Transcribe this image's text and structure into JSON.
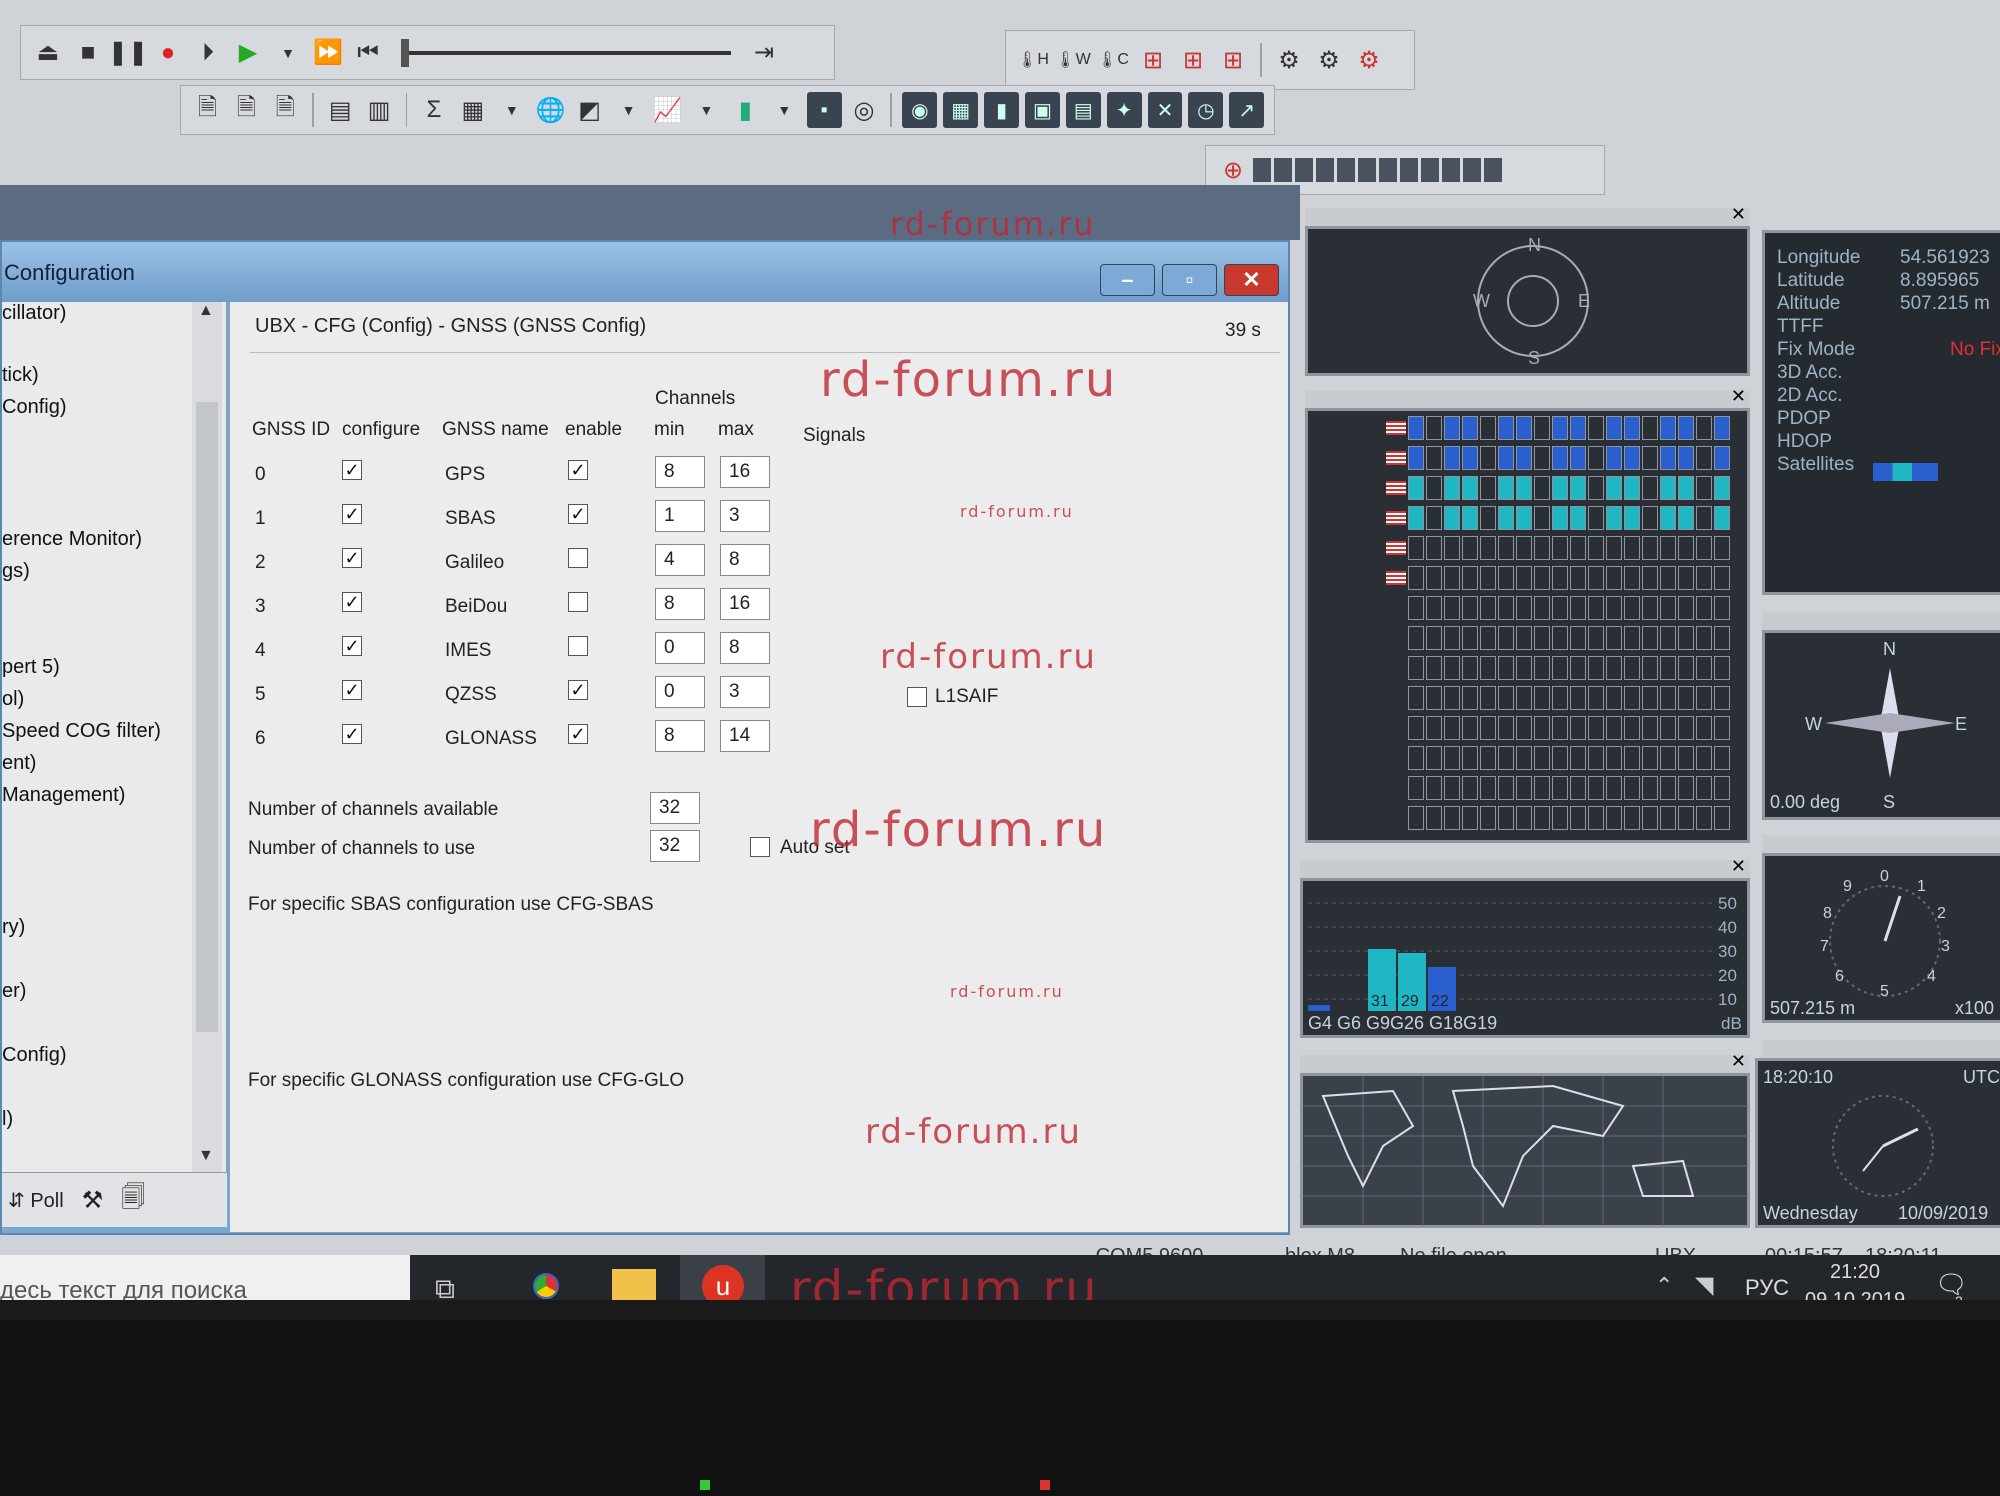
{
  "toolbar": {
    "playback_icons": [
      "eject-icon",
      "stop-icon",
      "pause-icon",
      "record-icon",
      "step-icon",
      "play-icon",
      "dropdown-icon",
      "fast-forward-icon",
      "skip-start-icon"
    ],
    "end_icon": "skip-end-icon",
    "view_icons_row1": [
      "H",
      "W",
      "C"
    ]
  },
  "watermark": "rd-forum.ru",
  "config_window": {
    "title": "Configuration",
    "page_title": "UBX - CFG (Config) - GNSS (GNSS Config)",
    "timer": "39 s",
    "nav_items": [
      "cillator)",
      "tick)",
      "Config)",
      "erence Monitor)",
      "gs)",
      "pert 5)",
      "ol)",
      "Speed COG filter)",
      "ent)",
      "Management)",
      "ry)",
      "er)",
      "Config)",
      "l)"
    ],
    "poll_label": "Poll",
    "headers": {
      "channels": "Channels",
      "gnss_id": "GNSS ID",
      "configure": "configure",
      "gnss_name": "GNSS name",
      "enable": "enable",
      "min": "min",
      "max": "max",
      "signals": "Signals"
    },
    "rows": [
      {
        "id": "0",
        "name": "GPS",
        "configure": true,
        "enable": true,
        "min": "8",
        "max": "16"
      },
      {
        "id": "1",
        "name": "SBAS",
        "configure": true,
        "enable": true,
        "min": "1",
        "max": "3"
      },
      {
        "id": "2",
        "name": "Galileo",
        "configure": true,
        "enable": false,
        "min": "4",
        "max": "8"
      },
      {
        "id": "3",
        "name": "BeiDou",
        "configure": true,
        "enable": false,
        "min": "8",
        "max": "16"
      },
      {
        "id": "4",
        "name": "IMES",
        "configure": true,
        "enable": false,
        "min": "0",
        "max": "8"
      },
      {
        "id": "5",
        "name": "QZSS",
        "configure": true,
        "enable": true,
        "min": "0",
        "max": "3"
      },
      {
        "id": "6",
        "name": "GLONASS",
        "configure": true,
        "enable": true,
        "min": "8",
        "max": "14"
      }
    ],
    "l1saif_label": "L1SAIF",
    "channels_available_label": "Number of channels available",
    "channels_available": "32",
    "channels_to_use_label": "Number of channels to use",
    "channels_to_use": "32",
    "auto_set_label": "Auto set",
    "sbas_note": "For specific SBAS configuration use CFG-SBAS",
    "glonass_note": "For specific GLONASS configuration use CFG-GLO"
  },
  "sky_view": {
    "n": "N",
    "s": "S",
    "e": "E",
    "w": "W"
  },
  "data_panel": {
    "labels": [
      "Longitude",
      "Latitude",
      "Altitude",
      "TTFF",
      "Fix Mode",
      "3D Acc.",
      "2D Acc.",
      "PDOP",
      "HDOP",
      "Satellites"
    ],
    "longitude": "54.561923",
    "latitude": "8.895965",
    "altitude": "507.215 m",
    "fix_mode": "No Fix"
  },
  "compass": {
    "n": "N",
    "s": "S",
    "e": "E",
    "w": "W",
    "heading": "0.00 deg"
  },
  "signal_chart": {
    "scale": [
      "50",
      "40",
      "30",
      "20",
      "10"
    ],
    "unit": "dB",
    "labels": "G4 G6 G9G26 G18G19",
    "values_text": [
      "31",
      "29",
      "22"
    ]
  },
  "altimeter": {
    "value": "507.215 m",
    "mult": "x100",
    "dial": [
      "0",
      "1",
      "2",
      "3",
      "4",
      "5",
      "6",
      "7",
      "8",
      "9"
    ]
  },
  "clock": {
    "time": "18:20:10",
    "zone": "UTC",
    "day": "Wednesday",
    "date": "10/09/2019"
  },
  "status": {
    "port": "COM5 9600",
    "receiver": "blox M8",
    "file": "No file open",
    "protocol": "UBX",
    "elapsed": "00:15:57",
    "clock": "18:20:11"
  },
  "taskbar": {
    "search_placeholder": "десь текст для поиска",
    "lang": "РУС",
    "time": "21:20",
    "date": "09.10.2019",
    "notif_count": "2"
  }
}
